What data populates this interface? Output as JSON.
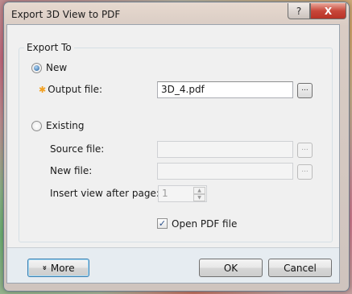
{
  "window": {
    "title": "Export 3D View to PDF",
    "help_label": "?",
    "close_label": "X"
  },
  "export_to": {
    "group_label": "Export To",
    "new_label": "New",
    "new_selected": true,
    "output_file_label": "Output file:",
    "output_file_value": "3D_4.pdf",
    "existing_label": "Existing",
    "existing_selected": false,
    "source_file_label": "Source file:",
    "source_file_value": "",
    "new_file_label": "New file:",
    "new_file_value": "",
    "insert_view_label": "Insert view after page:",
    "insert_view_value": "1",
    "browse_label": "...",
    "open_pdf_label": "Open PDF file",
    "open_pdf_checked": true,
    "required_icon": "asterisk-icon"
  },
  "buttons": {
    "more_label": "More",
    "more_icon": "double-chevron-down-icon",
    "ok_label": "OK",
    "cancel_label": "Cancel"
  },
  "colors": {
    "required_star": "#f2a020",
    "radio_dot": "#1b5c9c",
    "bottom_bar": "#e6ecf1"
  }
}
